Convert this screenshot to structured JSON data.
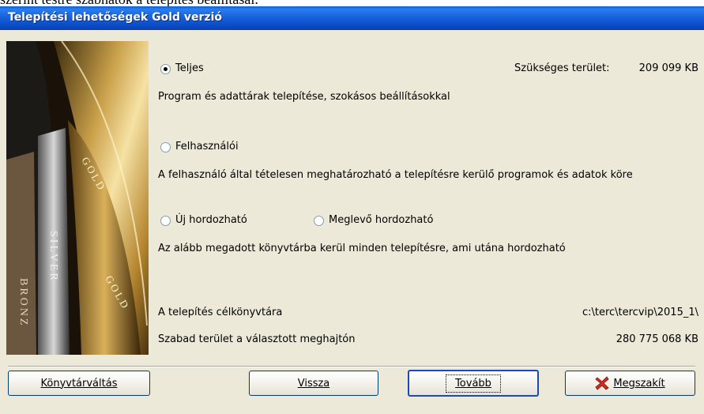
{
  "top_fragment": "szerint testre szabhatók a telepítés beállításai.",
  "window": {
    "title": "Telepítési lehetőségek  Gold verzió"
  },
  "side_image": {
    "texts": [
      "BRONZ",
      "SILVER",
      "GOLD",
      "GOLD"
    ]
  },
  "options": {
    "full": {
      "label": "Teljes",
      "description": "Program és adattárak telepítése, szokásos beállításokkal",
      "required_label": "Szükséges terület:",
      "required_value": "209 099 KB",
      "checked": true
    },
    "custom": {
      "label": "Felhasználói",
      "description": "A felhasználó által tételesen meghatározható a telepítésre kerülő programok és  adatok köre",
      "checked": false
    },
    "new_portable": {
      "label": "Új hordozható",
      "checked": false
    },
    "existing_portable": {
      "label": "Meglevő hordozható",
      "checked": false
    },
    "portable_description": "Az alább megadott könyvtárba kerül minden telepítésre, ami utána hordozható"
  },
  "target": {
    "label": "A telepítés célkönyvtára",
    "value": "c:\\terc\\tercvip\\2015_1\\",
    "free_label": "Szabad terület a választott meghajtón",
    "free_value": "280 775 068 KB"
  },
  "buttons": {
    "change_dir": "Könyvtárváltás",
    "back": "Vissza",
    "next": "Tovább",
    "cancel": "Megszakít"
  },
  "colors": {
    "titlebar": "#0b4cc6",
    "window_bg": "#ece9d8",
    "cancel_icon": "#d42c1c"
  },
  "icons": {
    "cancel": "red-x-icon"
  }
}
